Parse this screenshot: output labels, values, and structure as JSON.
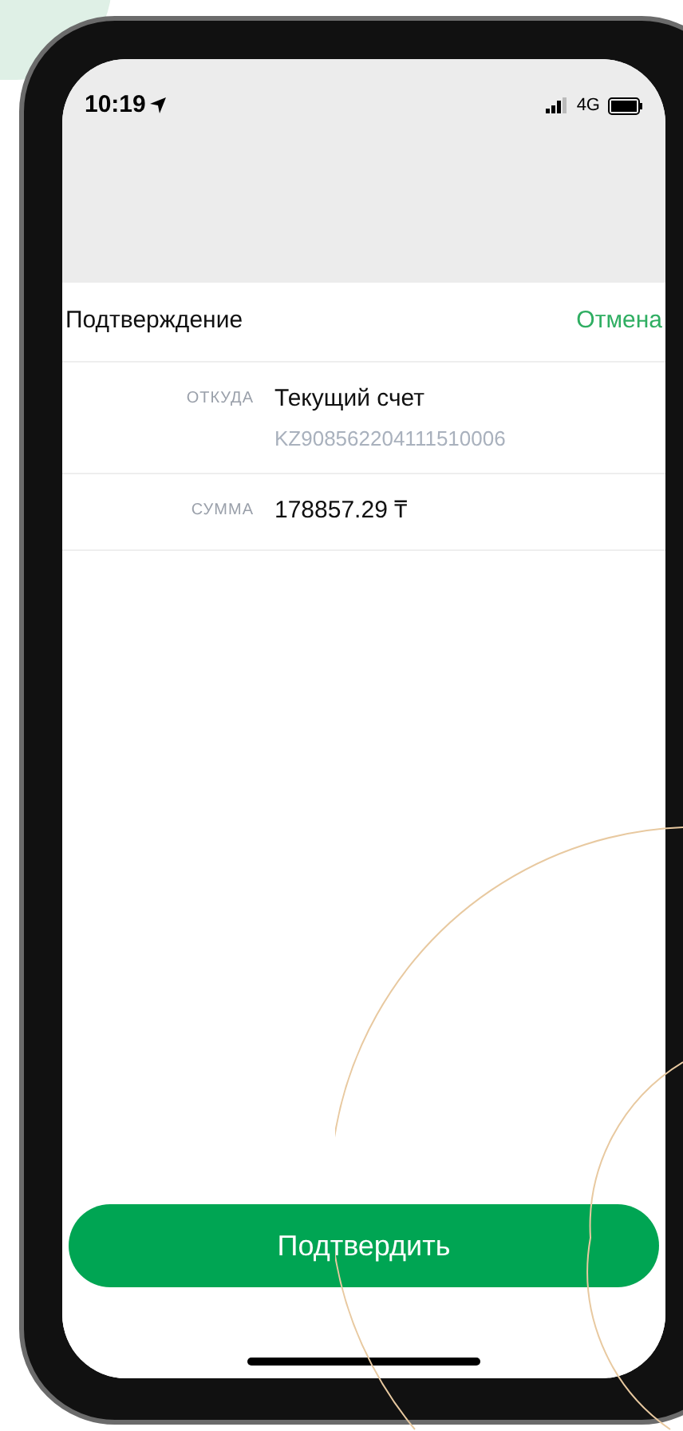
{
  "status_bar": {
    "time": "10:19",
    "network": "4G"
  },
  "sheet": {
    "title": "Подтверждение",
    "cancel": "Отмена"
  },
  "details": [
    {
      "label": "ОТКУДА",
      "value": "Текущий счет",
      "subvalue": "KZ908562204111510006"
    },
    {
      "label": "СУММА",
      "value": "178857.29 ₸"
    }
  ],
  "confirm_button": "Подтвердить"
}
